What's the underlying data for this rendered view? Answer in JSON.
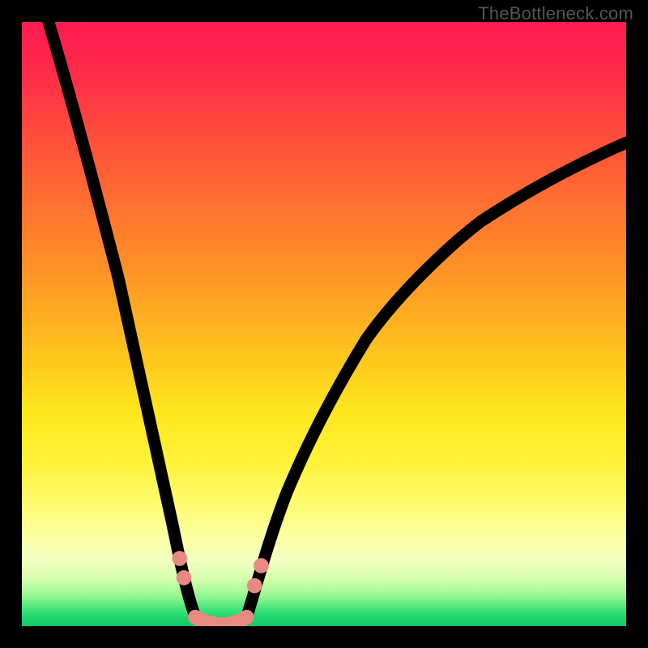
{
  "watermark": {
    "text": "TheBottleneck.com"
  },
  "colors": {
    "background": "#000000",
    "salmon": "#e98a82",
    "curve": "#000000",
    "gradient_stops": [
      "#ff1a52",
      "#ff2a4a",
      "#ff4a3c",
      "#ff7030",
      "#ff9626",
      "#ffc41e",
      "#ffe81e",
      "#fff23a",
      "#fefc70",
      "#fcffa0",
      "#f3ffc0",
      "#d9ffb0",
      "#96f792",
      "#4ae67a",
      "#1cd66e",
      "#16c566"
    ]
  },
  "chart_data": {
    "type": "line",
    "title": "",
    "xlabel": "",
    "ylabel": "",
    "xlim": [
      0,
      100
    ],
    "ylim": [
      0,
      100
    ],
    "grid": false,
    "legend": false,
    "notes": "No axis ticks or numeric labels are rendered; values are inferred on a 0–100 normalized plot box.",
    "series": [
      {
        "name": "left-descent",
        "description": "Steep curve descending from near top-left toward the valley floor.",
        "points": [
          {
            "x": 4.4,
            "y": 100.0
          },
          {
            "x": 8.0,
            "y": 88.0
          },
          {
            "x": 12.0,
            "y": 73.0
          },
          {
            "x": 16.0,
            "y": 57.5
          },
          {
            "x": 19.5,
            "y": 42.0
          },
          {
            "x": 22.5,
            "y": 28.0
          },
          {
            "x": 25.0,
            "y": 16.5
          },
          {
            "x": 26.8,
            "y": 8.0
          },
          {
            "x": 28.7,
            "y": 1.5
          }
        ]
      },
      {
        "name": "right-ascent",
        "description": "Curve rising from the valley floor toward the upper-right edge.",
        "points": [
          {
            "x": 37.2,
            "y": 1.5
          },
          {
            "x": 39.6,
            "y": 10.0
          },
          {
            "x": 44.0,
            "y": 22.5
          },
          {
            "x": 50.0,
            "y": 36.0
          },
          {
            "x": 57.0,
            "y": 47.5
          },
          {
            "x": 66.0,
            "y": 58.5
          },
          {
            "x": 76.0,
            "y": 67.0
          },
          {
            "x": 88.0,
            "y": 74.3
          },
          {
            "x": 100.0,
            "y": 80.0
          }
        ]
      },
      {
        "name": "valley-floor",
        "description": "Salmon U-shaped segment at the bottom connecting the two branches.",
        "points": [
          {
            "x": 28.7,
            "y": 1.5
          },
          {
            "x": 30.5,
            "y": 0.5
          },
          {
            "x": 33.0,
            "y": 0.2
          },
          {
            "x": 35.5,
            "y": 0.5
          },
          {
            "x": 37.2,
            "y": 1.5
          }
        ]
      }
    ],
    "markers": [
      {
        "series": "left-dots",
        "x": 26.1,
        "y": 11.2
      },
      {
        "series": "left-dots",
        "x": 26.8,
        "y": 8.0
      },
      {
        "series": "right-dots",
        "x": 38.5,
        "y": 6.7
      },
      {
        "series": "right-dots",
        "x": 39.6,
        "y": 10.0
      }
    ]
  }
}
